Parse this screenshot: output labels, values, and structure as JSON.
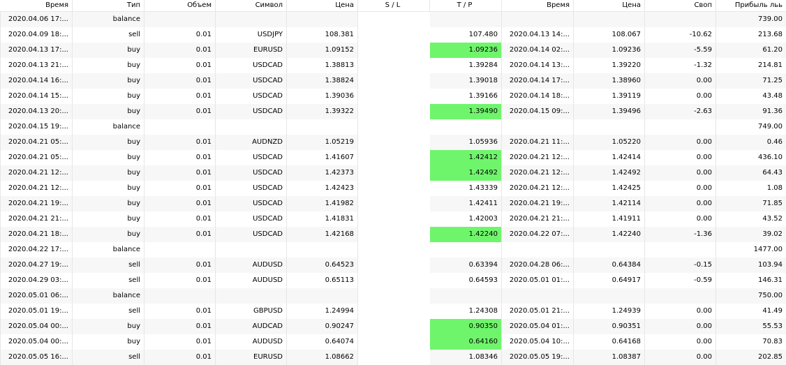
{
  "headers": [
    "Время",
    "Тип",
    "Объем",
    "Символ",
    "Цена",
    "S / L",
    "T / P",
    "Время",
    "Цена",
    "Своп",
    "Прибыль"
  ],
  "headers_extra": "льь",
  "rows": [
    {
      "time": "2020.04.06 17:...",
      "type": "balance",
      "volume": "",
      "symbol": "",
      "price": "",
      "sl": "",
      "tp": "",
      "tp_hit": false,
      "close_time": "",
      "close_price": "",
      "swap": "",
      "profit": "739.00"
    },
    {
      "time": "2020.04.09 18:...",
      "type": "sell",
      "volume": "0.01",
      "symbol": "USDJPY",
      "price": "108.381",
      "sl": "",
      "tp": "107.480",
      "tp_hit": false,
      "close_time": "2020.04.13 14:...",
      "close_price": "108.067",
      "swap": "-10.62",
      "profit": "213.68"
    },
    {
      "time": "2020.04.13 17:...",
      "type": "buy",
      "volume": "0.01",
      "symbol": "EURUSD",
      "price": "1.09152",
      "sl": "",
      "tp": "1.09236",
      "tp_hit": true,
      "close_time": "2020.04.14 02:...",
      "close_price": "1.09236",
      "swap": "-5.59",
      "profit": "61.20"
    },
    {
      "time": "2020.04.13 21:...",
      "type": "buy",
      "volume": "0.01",
      "symbol": "USDCAD",
      "price": "1.38813",
      "sl": "",
      "tp": "1.39284",
      "tp_hit": false,
      "close_time": "2020.04.14 13:...",
      "close_price": "1.39220",
      "swap": "-1.32",
      "profit": "214.81"
    },
    {
      "time": "2020.04.14 16:...",
      "type": "buy",
      "volume": "0.01",
      "symbol": "USDCAD",
      "price": "1.38824",
      "sl": "",
      "tp": "1.39018",
      "tp_hit": false,
      "close_time": "2020.04.14 17:...",
      "close_price": "1.38960",
      "swap": "0.00",
      "profit": "71.25"
    },
    {
      "time": "2020.04.14 15:...",
      "type": "buy",
      "volume": "0.01",
      "symbol": "USDCAD",
      "price": "1.39036",
      "sl": "",
      "tp": "1.39166",
      "tp_hit": false,
      "close_time": "2020.04.14 18:...",
      "close_price": "1.39119",
      "swap": "0.00",
      "profit": "43.48"
    },
    {
      "time": "2020.04.13 20:...",
      "type": "buy",
      "volume": "0.01",
      "symbol": "USDCAD",
      "price": "1.39322",
      "sl": "",
      "tp": "1.39490",
      "tp_hit": true,
      "close_time": "2020.04.15 09:...",
      "close_price": "1.39496",
      "swap": "-2.63",
      "profit": "91.36"
    },
    {
      "time": "2020.04.15 19:...",
      "type": "balance",
      "volume": "",
      "symbol": "",
      "price": "",
      "sl": "",
      "tp": "",
      "tp_hit": false,
      "close_time": "",
      "close_price": "",
      "swap": "",
      "profit": "749.00"
    },
    {
      "time": "2020.04.21 05:...",
      "type": "buy",
      "volume": "0.01",
      "symbol": "AUDNZD",
      "price": "1.05219",
      "sl": "",
      "tp": "1.05936",
      "tp_hit": false,
      "close_time": "2020.04.21 11:...",
      "close_price": "1.05220",
      "swap": "0.00",
      "profit": "0.46"
    },
    {
      "time": "2020.04.21 05:...",
      "type": "buy",
      "volume": "0.01",
      "symbol": "USDCAD",
      "price": "1.41607",
      "sl": "",
      "tp": "1.42412",
      "tp_hit": true,
      "close_time": "2020.04.21 12:...",
      "close_price": "1.42414",
      "swap": "0.00",
      "profit": "436.10"
    },
    {
      "time": "2020.04.21 12:...",
      "type": "buy",
      "volume": "0.01",
      "symbol": "USDCAD",
      "price": "1.42373",
      "sl": "",
      "tp": "1.42492",
      "tp_hit": true,
      "close_time": "2020.04.21 12:...",
      "close_price": "1.42492",
      "swap": "0.00",
      "profit": "64.43"
    },
    {
      "time": "2020.04.21 12:...",
      "type": "buy",
      "volume": "0.01",
      "symbol": "USDCAD",
      "price": "1.42423",
      "sl": "",
      "tp": "1.43339",
      "tp_hit": false,
      "close_time": "2020.04.21 12:...",
      "close_price": "1.42425",
      "swap": "0.00",
      "profit": "1.08"
    },
    {
      "time": "2020.04.21 19:...",
      "type": "buy",
      "volume": "0.01",
      "symbol": "USDCAD",
      "price": "1.41982",
      "sl": "",
      "tp": "1.42411",
      "tp_hit": false,
      "close_time": "2020.04.21 19:...",
      "close_price": "1.42114",
      "swap": "0.00",
      "profit": "71.85"
    },
    {
      "time": "2020.04.21 21:...",
      "type": "buy",
      "volume": "0.01",
      "symbol": "USDCAD",
      "price": "1.41831",
      "sl": "",
      "tp": "1.42003",
      "tp_hit": false,
      "close_time": "2020.04.21 21:...",
      "close_price": "1.41911",
      "swap": "0.00",
      "profit": "43.52"
    },
    {
      "time": "2020.04.21 18:...",
      "type": "buy",
      "volume": "0.01",
      "symbol": "USDCAD",
      "price": "1.42168",
      "sl": "",
      "tp": "1.42240",
      "tp_hit": true,
      "close_time": "2020.04.22 07:...",
      "close_price": "1.42240",
      "swap": "-1.36",
      "profit": "39.02"
    },
    {
      "time": "2020.04.22 17:...",
      "type": "balance",
      "volume": "",
      "symbol": "",
      "price": "",
      "sl": "",
      "tp": "",
      "tp_hit": false,
      "close_time": "",
      "close_price": "",
      "swap": "",
      "profit": "1477.00"
    },
    {
      "time": "2020.04.27 19:...",
      "type": "sell",
      "volume": "0.01",
      "symbol": "AUDUSD",
      "price": "0.64523",
      "sl": "",
      "tp": "0.63394",
      "tp_hit": false,
      "close_time": "2020.04.28 06:...",
      "close_price": "0.64384",
      "swap": "-0.15",
      "profit": "103.94"
    },
    {
      "time": "2020.04.29 03:...",
      "type": "sell",
      "volume": "0.01",
      "symbol": "AUDUSD",
      "price": "0.65113",
      "sl": "",
      "tp": "0.64593",
      "tp_hit": false,
      "close_time": "2020.05.01 01:...",
      "close_price": "0.64917",
      "swap": "-0.59",
      "profit": "146.31"
    },
    {
      "time": "2020.05.01 06:...",
      "type": "balance",
      "volume": "",
      "symbol": "",
      "price": "",
      "sl": "",
      "tp": "",
      "tp_hit": false,
      "close_time": "",
      "close_price": "",
      "swap": "",
      "profit": "750.00"
    },
    {
      "time": "2020.05.01 19:...",
      "type": "sell",
      "volume": "0.01",
      "symbol": "GBPUSD",
      "price": "1.24994",
      "sl": "",
      "tp": "1.24308",
      "tp_hit": false,
      "close_time": "2020.05.01 21:...",
      "close_price": "1.24939",
      "swap": "0.00",
      "profit": "41.49"
    },
    {
      "time": "2020.05.04 00:...",
      "type": "buy",
      "volume": "0.01",
      "symbol": "AUDCAD",
      "price": "0.90247",
      "sl": "",
      "tp": "0.90350",
      "tp_hit": true,
      "close_time": "2020.05.04 01:...",
      "close_price": "0.90351",
      "swap": "0.00",
      "profit": "55.53"
    },
    {
      "time": "2020.05.04 00:...",
      "type": "buy",
      "volume": "0.01",
      "symbol": "AUDUSD",
      "price": "0.64074",
      "sl": "",
      "tp": "0.64160",
      "tp_hit": true,
      "close_time": "2020.05.04 10:...",
      "close_price": "0.64168",
      "swap": "0.00",
      "profit": "70.83"
    },
    {
      "time": "2020.05.05 16:...",
      "type": "sell",
      "volume": "0.01",
      "symbol": "EURUSD",
      "price": "1.08662",
      "sl": "",
      "tp": "1.08346",
      "tp_hit": false,
      "close_time": "2020.05.05 19:...",
      "close_price": "1.08387",
      "swap": "0.00",
      "profit": "202.85"
    }
  ],
  "colors": {
    "tp_hit": "#6ff56b",
    "row_alt": "#f7f7f7",
    "grid": "#e6e6e6"
  }
}
